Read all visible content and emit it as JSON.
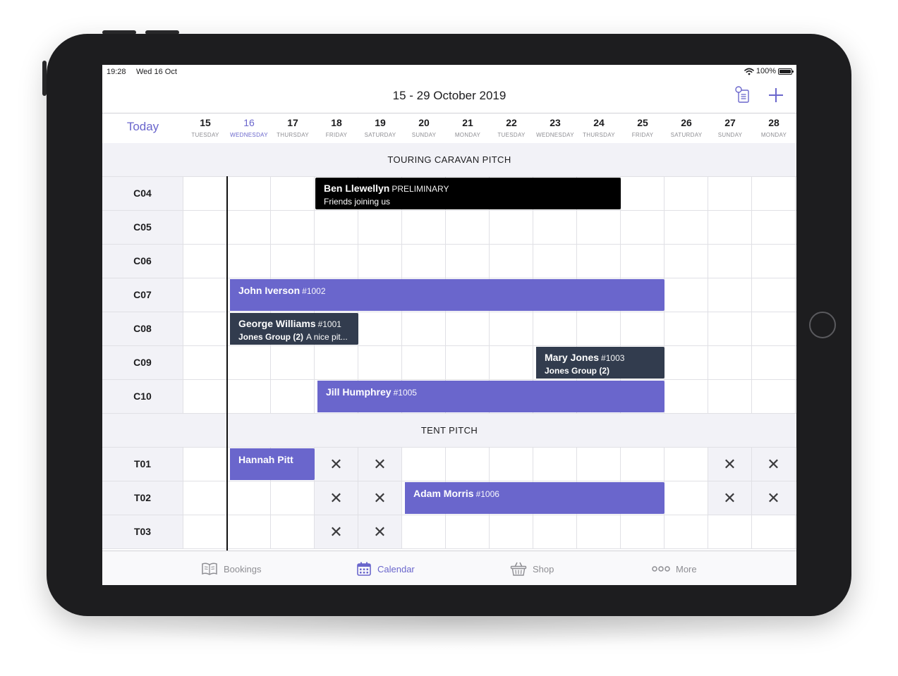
{
  "status_bar": {
    "time": "19:28",
    "date": "Wed 16 Oct",
    "battery": "100%"
  },
  "nav": {
    "title": "15 - 29 October 2019",
    "icons": [
      "notes-icon",
      "plus-icon"
    ]
  },
  "header": {
    "today_label": "Today",
    "days": [
      {
        "num": "15",
        "name": "TUESDAY"
      },
      {
        "num": "16",
        "name": "WEDNESDAY",
        "current": true
      },
      {
        "num": "17",
        "name": "THURSDAY"
      },
      {
        "num": "18",
        "name": "FRIDAY"
      },
      {
        "num": "19",
        "name": "SATURDAY"
      },
      {
        "num": "20",
        "name": "SUNDAY"
      },
      {
        "num": "21",
        "name": "MONDAY"
      },
      {
        "num": "22",
        "name": "TUESDAY"
      },
      {
        "num": "23",
        "name": "WEDNESDAY"
      },
      {
        "num": "24",
        "name": "THURSDAY"
      },
      {
        "num": "25",
        "name": "FRIDAY"
      },
      {
        "num": "26",
        "name": "SATURDAY"
      },
      {
        "num": "27",
        "name": "SUNDAY"
      },
      {
        "num": "28",
        "name": "MONDAY"
      }
    ]
  },
  "sections": [
    {
      "title": "TOURING CARAVAN PITCH",
      "rows": [
        {
          "label": "C04",
          "blocked": [],
          "bookings": [
            {
              "name": "Ben Llewellyn",
              "ref": "PRELIMINARY",
              "sub": "Friends joining us",
              "style": "black",
              "start": 3,
              "end": 10
            }
          ]
        },
        {
          "label": "C05",
          "blocked": [],
          "bookings": []
        },
        {
          "label": "C06",
          "blocked": [],
          "bookings": []
        },
        {
          "label": "C07",
          "blocked": [],
          "bookings": [
            {
              "name": "John Iverson",
              "ref": "#1002",
              "style": "purple",
              "start": 1,
              "end": 11
            }
          ]
        },
        {
          "label": "C08",
          "blocked": [],
          "bookings": [
            {
              "name": "George Williams",
              "ref": "#1001",
              "group": "Jones Group (2)",
              "note": "A nice pit...",
              "style": "slate",
              "start": 1,
              "end": 4
            }
          ]
        },
        {
          "label": "C09",
          "blocked": [],
          "bookings": [
            {
              "name": "Mary Jones",
              "ref": "#1003",
              "group": "Jones Group (2)",
              "style": "slate",
              "start": 8,
              "end": 11
            }
          ]
        },
        {
          "label": "C10",
          "blocked": [],
          "bookings": [
            {
              "name": "Jill Humphrey",
              "ref": "#1005",
              "style": "purple",
              "start": 3,
              "end": 11
            }
          ]
        }
      ]
    },
    {
      "title": "TENT PITCH",
      "rows": [
        {
          "label": "T01",
          "blocked": [
            3,
            4,
            12,
            13
          ],
          "bookings": [
            {
              "name": "Hannah Pitt",
              "style": "purple",
              "start": 1,
              "end": 3
            }
          ]
        },
        {
          "label": "T02",
          "blocked": [
            3,
            4,
            12,
            13
          ],
          "bookings": [
            {
              "name": "Adam Morris",
              "ref": "#1006",
              "style": "purple",
              "start": 5,
              "end": 11
            }
          ]
        },
        {
          "label": "T03",
          "blocked": [
            3,
            4
          ],
          "bookings": []
        }
      ]
    }
  ],
  "blocked_glyph": "✕",
  "tabs": [
    {
      "label": "Bookings",
      "icon": "book-icon",
      "active": false
    },
    {
      "label": "Calendar",
      "icon": "calendar-icon",
      "active": true
    },
    {
      "label": "Shop",
      "icon": "basket-icon",
      "active": false
    },
    {
      "label": "More",
      "icon": "more-icon",
      "active": false
    }
  ],
  "colors": {
    "accent": "#6a66cc",
    "booking_purple": "#6a66cc",
    "booking_slate": "#323c4e",
    "booking_preliminary": "#000000"
  }
}
